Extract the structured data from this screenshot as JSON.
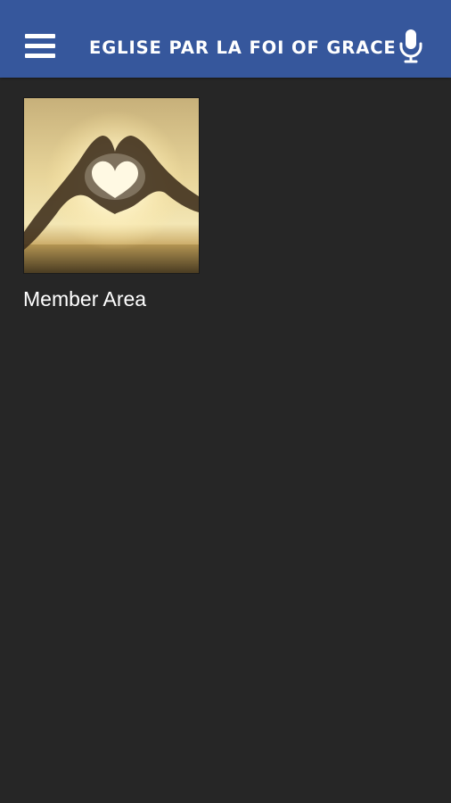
{
  "app": {
    "title": "EGLISE PAR LA FOI OF GRACE",
    "header_color": "#36579c",
    "background_color": "#262626"
  },
  "header": {
    "menu_icon": "hamburger-menu-icon",
    "mic_icon": "microphone-icon"
  },
  "tiles": [
    {
      "label": "Member Area",
      "image": "heart-hands-sunset-photo"
    }
  ]
}
